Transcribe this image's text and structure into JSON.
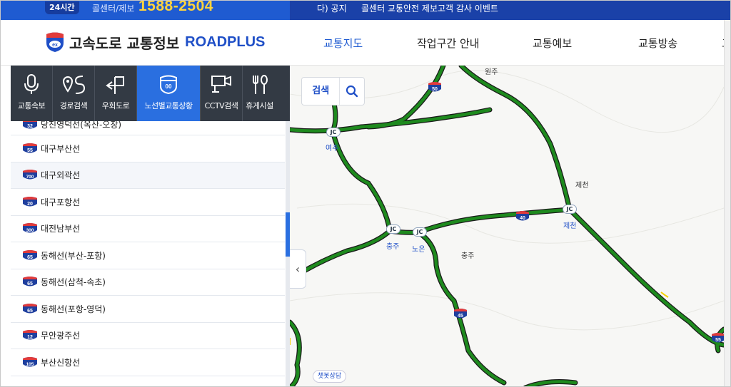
{
  "topbar": {
    "badge": "24시간",
    "center_label": "콜센터/제보",
    "phone": "1588-2504",
    "notice_tag": "다) 공지",
    "notice_text": "콜센터 교통안전 제보고객 감사 이벤트"
  },
  "header": {
    "logo_text": "고속도로 교통정보",
    "logo_brand": "ROADPLUS",
    "nav": [
      "교통지도",
      "작업구간 안내",
      "교통예보",
      "교통방송",
      "고"
    ]
  },
  "tabs": [
    {
      "label": "교통속보",
      "icon": "microphone-icon"
    },
    {
      "label": "경로검색",
      "icon": "route-pin-icon"
    },
    {
      "label": "우회도로",
      "icon": "detour-arrow-icon"
    },
    {
      "label": "노선별교통상황",
      "icon": "route-shield-icon"
    },
    {
      "label": "CCTV검색",
      "icon": "cctv-icon"
    },
    {
      "label": "휴게시설",
      "icon": "fork-spoon-icon"
    }
  ],
  "routes": [
    {
      "num": "32",
      "name": "당진영덕선(옥산-오창)"
    },
    {
      "num": "55",
      "name": "대구부산선"
    },
    {
      "num": "700",
      "name": "대구외곽선"
    },
    {
      "num": "20",
      "name": "대구포항선"
    },
    {
      "num": "300",
      "name": "대전남부선"
    },
    {
      "num": "65",
      "name": "동해선(부산-포항)"
    },
    {
      "num": "65",
      "name": "동해선(삼척-속초)"
    },
    {
      "num": "65",
      "name": "동해선(포항-영덕)"
    },
    {
      "num": "12",
      "name": "무안광주선"
    },
    {
      "num": "105",
      "name": "부산신항선"
    }
  ],
  "search": {
    "label": "검색"
  },
  "map": {
    "places": [
      "원주",
      "제천",
      "충주",
      "여주",
      "충주",
      "노은",
      "제천"
    ],
    "shields": [
      "50",
      "40",
      "45",
      "55"
    ],
    "jc_label": "JC",
    "chatbot": "챗봇상담"
  },
  "colors": {
    "accent": "#2a6fe0",
    "road": "#1e8a1e",
    "tab_bg": "#333a44"
  }
}
